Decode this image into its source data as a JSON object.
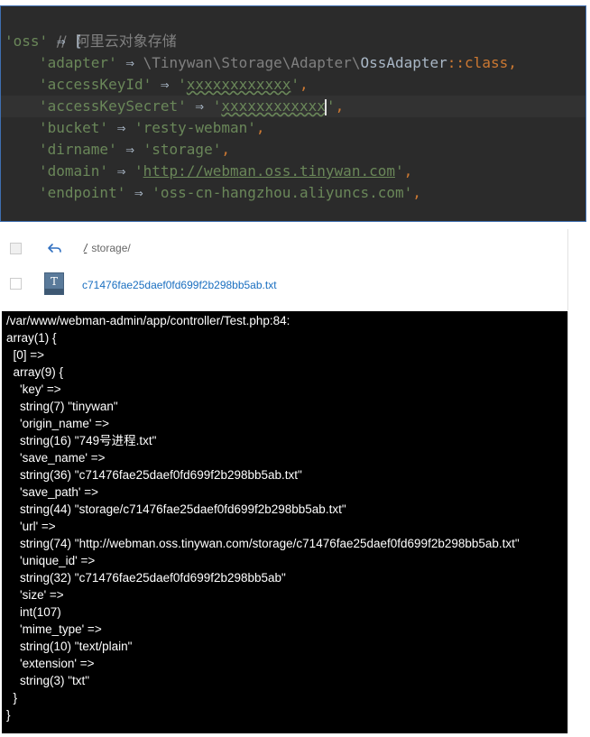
{
  "editor": {
    "comment": "//  阿里云对象存储",
    "key_oss": "'oss'",
    "arrow": "⇒",
    "open_bracket": "[",
    "close_bracket": "],",
    "rows": [
      {
        "key": "'adapter'",
        "value_path": "\\Tinywan\\Storage\\Adapter\\",
        "value_class": "OssAdapter",
        "value_sep": "::",
        "value_kw": "class",
        "comma": ","
      },
      {
        "key": "'accessKeyId'",
        "value": "xxxxxxxxxxxx",
        "comma": ","
      },
      {
        "key": "'accessKeySecret'",
        "value": "xxxxxxxxxxxx",
        "comma": ","
      },
      {
        "key": "'bucket'",
        "value": "resty-webman",
        "comma": ","
      },
      {
        "key": "'dirname'",
        "value": "storage",
        "comma": ","
      },
      {
        "key": "'domain'",
        "value": "http://webman.oss.tinywan.com",
        "comma": ","
      },
      {
        "key": "'endpoint'",
        "value": "oss-cn-hangzhou.aliyuncs.com",
        "comma": ","
      }
    ]
  },
  "filebrowser": {
    "path_prefix": "/",
    "path": "storage/",
    "file_icon_letter": "T",
    "file_name": "c71476fae25daef0fd699f2b298bb5ab.txt"
  },
  "terminal": {
    "lines": [
      "/var/www/webman-admin/app/controller/Test.php:84:",
      "array(1) {",
      "  [0] =>",
      "  array(9) {",
      "    'key' =>",
      "    string(7) \"tinywan\"",
      "    'origin_name' =>",
      "    string(16) \"749号进程.txt\"",
      "    'save_name' =>",
      "    string(36) \"c71476fae25daef0fd699f2b298bb5ab.txt\"",
      "    'save_path' =>",
      "    string(44) \"storage/c71476fae25daef0fd699f2b298bb5ab.txt\"",
      "    'url' =>",
      "    string(74) \"http://webman.oss.tinywan.com/storage/c71476fae25daef0fd699f2b298bb5ab.txt\"",
      "    'unique_id' =>",
      "    string(32) \"c71476fae25daef0fd699f2b298bb5ab\"",
      "    'size' =>",
      "    int(107)",
      "    'mime_type' =>",
      "    string(10) \"text/plain\"",
      "    'extension' =>",
      "    string(3) \"txt\"",
      "  }",
      "}"
    ]
  },
  "icons": {
    "back": "back-arrow-icon",
    "file": "text-file-icon",
    "checkbox": "checkbox-icon"
  },
  "colors": {
    "editor_bg": "#2b2b2b",
    "string_green": "#6a8759",
    "keyword_orange": "#cc7832",
    "comment_gray": "#808080",
    "link_blue": "#1a6fc0",
    "terminal_bg": "#000000"
  }
}
